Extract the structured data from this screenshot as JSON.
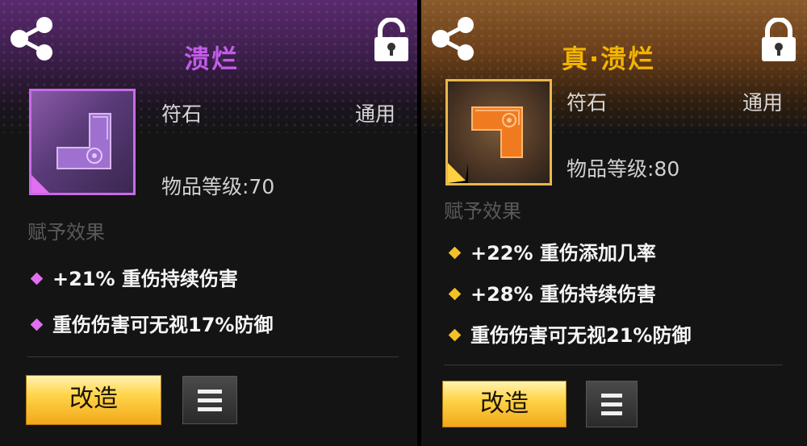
{
  "cards": [
    {
      "title": "溃烂",
      "item_type": "符石",
      "usage": "通用",
      "item_level": "物品等级:70",
      "effects_label": "赋予效果",
      "effects": [
        "+21% 重伤持续伤害",
        "重伤伤害可无视17%防御"
      ],
      "modify_button": "改造",
      "lock_state": "unlocked",
      "rarity_color": "#c25ce8",
      "icons": {
        "share": "share-icon",
        "lock": "unlock-icon",
        "menu": "menu-icon"
      }
    },
    {
      "title": "真·溃烂",
      "item_type": "符石",
      "usage": "通用",
      "item_level": "物品等级:80",
      "effects_label": "赋予效果",
      "effects": [
        "+22% 重伤添加几率",
        "+28% 重伤持续伤害",
        "重伤伤害可无视21%防御"
      ],
      "modify_button": "改造",
      "lock_state": "locked",
      "rarity_color": "#f2b400",
      "icons": {
        "share": "share-icon",
        "lock": "lock-icon",
        "menu": "menu-icon"
      }
    }
  ]
}
